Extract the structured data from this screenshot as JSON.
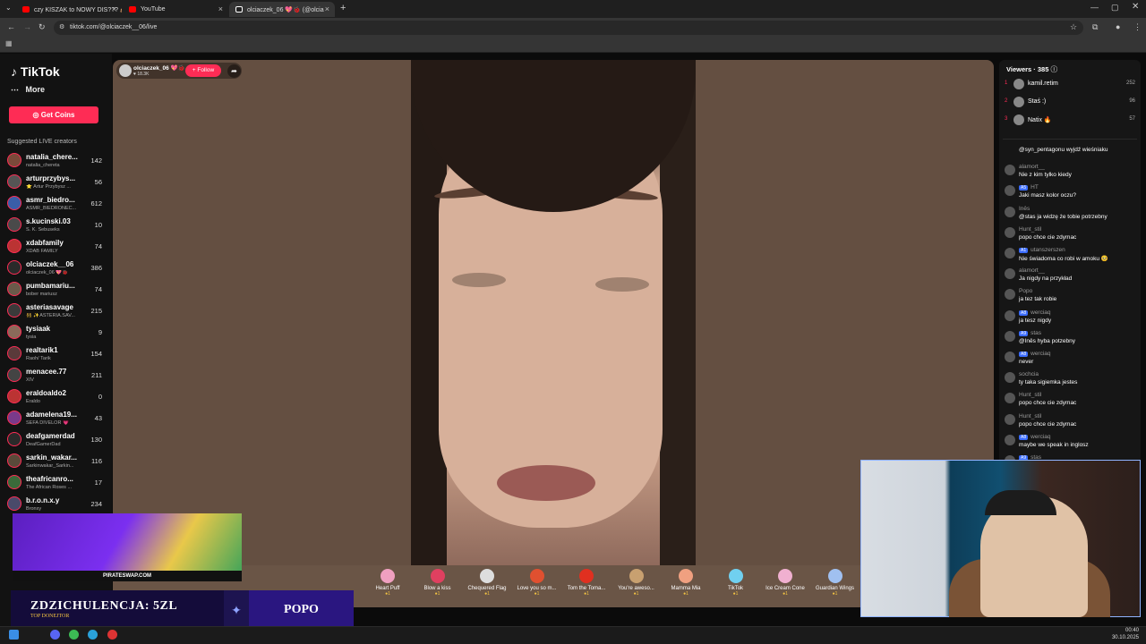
{
  "browser": {
    "tabs": [
      {
        "label": "czy KISZAK to NOWY DIS??? 🙈"
      },
      {
        "label": "YouTube"
      },
      {
        "label": "olciaczek_06 💖🐞 (@olcia"
      }
    ],
    "url": "tiktok.com/@olciaczek__06/live"
  },
  "sidebar": {
    "logo": "TikTok",
    "more": "More",
    "get_coins": "Get Coins",
    "suggested_title": "Suggested LIVE creators",
    "creators": [
      {
        "name": "natalia_chere...",
        "sub": "natalia_chereta",
        "viewers": "142",
        "color": "#7a4a3a"
      },
      {
        "name": "arturprzybys...",
        "sub": "⭐ Artur Przybysz ...",
        "viewers": "56",
        "color": "#555"
      },
      {
        "name": "asmr_biedro...",
        "sub": "ASMR_BIEDRONEC...",
        "viewers": "612",
        "color": "#3a5ea8"
      },
      {
        "name": "s.kucinski.03",
        "sub": "S. K. Sebuseks",
        "viewers": "10",
        "color": "#4a4a4a"
      },
      {
        "name": "xdabfamily",
        "sub": "XDAB FAMILY",
        "viewers": "74",
        "color": "#b33"
      },
      {
        "name": "olciaczek__06",
        "sub": "olciaczek_06 💖🐞",
        "viewers": "386",
        "color": "#2a2a2a"
      },
      {
        "name": "pumbamariu...",
        "sub": "bober mariusz",
        "viewers": "74",
        "color": "#6a5a4a"
      },
      {
        "name": "asteriasavage",
        "sub": "👯 ✨ASTERIA.SAV...",
        "viewers": "215",
        "color": "#3a3a3a"
      },
      {
        "name": "tysiaak",
        "sub": "tysia",
        "viewers": "9",
        "color": "#8a6a5a"
      },
      {
        "name": "realtarik1",
        "sub": "Raoh/ Tarik",
        "viewers": "154",
        "color": "#5a3a3a"
      },
      {
        "name": "menacee.77",
        "sub": "XIV",
        "viewers": "211",
        "color": "#444"
      },
      {
        "name": "eraldoaldo2",
        "sub": "Eraldo",
        "viewers": "0",
        "color": "#b33"
      },
      {
        "name": "adamelena19...",
        "sub": "SEFA DIVELOR 💗",
        "viewers": "43",
        "color": "#7a3a8a"
      },
      {
        "name": "deafgamerdad",
        "sub": "DeafGamerDad",
        "viewers": "130",
        "color": "#2a2a2a"
      },
      {
        "name": "sarkin_wakar...",
        "sub": "Sarkinwakar_Sarkin...",
        "viewers": "116",
        "color": "#5a4a3a"
      },
      {
        "name": "theafricanro...",
        "sub": "The African Roses ...",
        "viewers": "17",
        "color": "#3a6a3a"
      },
      {
        "name": "b.r.o.n.x.y",
        "sub": "Bronxy",
        "viewers": "234",
        "color": "#4a4a6a"
      }
    ]
  },
  "stream": {
    "host_name": "olciaczek_06 💖🐞",
    "host_likes": "♥ 18.3K",
    "follow": "+ Follow",
    "share_icon": "share-icon",
    "gifts": [
      {
        "label": "Heart Puff",
        "coins": "●1",
        "color": "#f0a0c0"
      },
      {
        "label": "Blow a kiss",
        "coins": "●1",
        "color": "#e04060"
      },
      {
        "label": "Chequered Flag",
        "coins": "●1",
        "color": "#ddd"
      },
      {
        "label": "Love you so m...",
        "coins": "●1",
        "color": "#e05030"
      },
      {
        "label": "Tom the Toma...",
        "coins": "●1",
        "color": "#e03020"
      },
      {
        "label": "You're aweso...",
        "coins": "●1",
        "color": "#c8a070"
      },
      {
        "label": "Mamma Mia",
        "coins": "●1",
        "color": "#f0a080"
      },
      {
        "label": "TikTok",
        "coins": "●1",
        "color": "#70d0f0"
      },
      {
        "label": "Ice Cream Cone",
        "coins": "●1",
        "color": "#f0b0d0"
      },
      {
        "label": "Guardian Wings",
        "coins": "●1",
        "color": "#a0c0f0"
      }
    ]
  },
  "viewers": {
    "title": "Viewers · 385",
    "top": [
      {
        "rank": "1",
        "name": "kamil.retim",
        "score": "252"
      },
      {
        "rank": "2",
        "name": "Staś :)",
        "score": "96"
      },
      {
        "rank": "3",
        "name": "Natix 🔥",
        "score": "57"
      }
    ]
  },
  "chat": [
    {
      "user": "",
      "badge": "",
      "text": "@syn_pentagonu wyjdź wieśniaku"
    },
    {
      "user": "alamort__",
      "badge": "",
      "text": "Nie z kim tylko kiedy"
    },
    {
      "user": "HT",
      "badge": "A5",
      "text": "Jaki masz kolor oczu?"
    },
    {
      "user": "Inês",
      "badge": "",
      "text": "@stas ja widzę że tobie potrzebny"
    },
    {
      "user": "Hunt_stil",
      "badge": "",
      "text": "popo chce cie zdymac"
    },
    {
      "user": "utanszerszen",
      "badge": "A1",
      "text": "Nie świadoma co robi w amoku 🥺"
    },
    {
      "user": "alamort__",
      "badge": "",
      "text": "Ja nigdy na przykład"
    },
    {
      "user": "Popo",
      "badge": "",
      "text": "ja tez tak robie"
    },
    {
      "user": "werciaq",
      "badge": "A8",
      "text": "ja tesz nigdy"
    },
    {
      "user": "stas",
      "badge": "A9",
      "text": "@Inês hyba potzebny"
    },
    {
      "user": "werciaq",
      "badge": "A8",
      "text": "never"
    },
    {
      "user": "sochcia",
      "badge": "",
      "text": "ty taka sigiemka jestes"
    },
    {
      "user": "Hunt_stil",
      "badge": "",
      "text": "popo chce cie zdymac"
    },
    {
      "user": "Hunt_stil",
      "badge": "",
      "text": "popo chce cie zdymac"
    },
    {
      "user": "werciaq",
      "badge": "A8",
      "text": "maybe we speak in inglosz"
    },
    {
      "user": "stas",
      "badge": "A9",
      "text": ""
    }
  ],
  "overlay": {
    "ad_label": "PIRATESWAP.COM",
    "donation": "ZDZICHULENCJA: 5ZL",
    "donation_label": "TOP DONEJTOR",
    "donor": "POPO"
  },
  "taskbar": {
    "time": "00:40",
    "date": "30.10.2025"
  }
}
